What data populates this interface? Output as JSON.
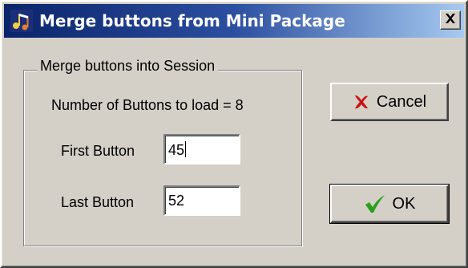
{
  "window": {
    "title": "Merge buttons from Mini Package",
    "close_label": "X"
  },
  "group": {
    "legend": "Merge buttons into Session",
    "count_text": "Number of Buttons to load = 8",
    "first_label": "First Button",
    "first_value": "45",
    "last_label": "Last Button",
    "last_value": "52"
  },
  "buttons": {
    "cancel_label": "Cancel",
    "ok_label": "OK"
  },
  "icons": {
    "app": "music-notes-icon",
    "close": "close-icon",
    "cancel": "red-x-icon",
    "ok": "green-check-icon"
  },
  "colors": {
    "titlebar_start": "#0a246a",
    "titlebar_end": "#a6caf0",
    "face": "#d4d0c8",
    "cancel_icon": "#cc1010",
    "ok_icon": "#2aa01a"
  }
}
